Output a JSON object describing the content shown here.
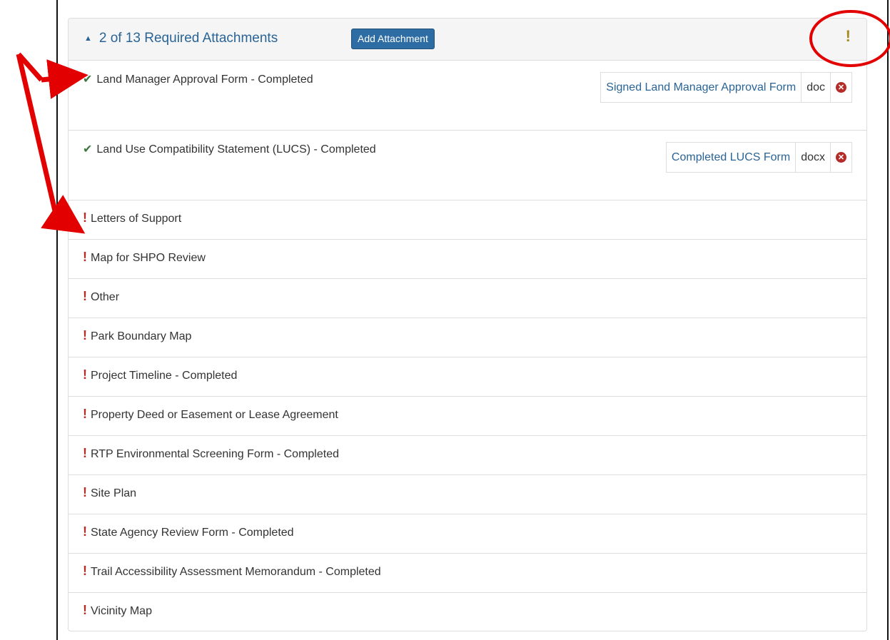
{
  "panel": {
    "heading": "2 of 13 Required Attachments",
    "add_button": "Add Attachment",
    "warning_icon": "!"
  },
  "icons": {
    "collapse": "caret-up-icon",
    "completed": "check-icon",
    "missing": "exclamation-icon",
    "delete": "remove-circle-icon"
  },
  "colors": {
    "link": "#2a6496",
    "button": "#2e6da4",
    "success": "#3c763d",
    "danger": "#b52b27",
    "warning": "#a68a24",
    "annotation": "#e30000"
  },
  "attachments": [
    {
      "label": "Land Manager Approval Form - Completed",
      "file_name": "Signed Land Manager Approval Form",
      "file_type": "doc"
    },
    {
      "label": "Land Use Compatibility Statement (LUCS) - Completed",
      "file_name": "Completed LUCS Form",
      "file_type": "docx"
    },
    {
      "label": "Letters of Support"
    },
    {
      "label": "Map for SHPO Review"
    },
    {
      "label": "Other"
    },
    {
      "label": "Park Boundary Map"
    },
    {
      "label": "Project Timeline - Completed"
    },
    {
      "label": "Property Deed or Easement or Lease Agreement"
    },
    {
      "label": "RTP Environmental Screening Form - Completed"
    },
    {
      "label": "Site Plan"
    },
    {
      "label": "State Agency Review Form - Completed"
    },
    {
      "label": "Trail Accessibility Assessment Memorandum - Completed"
    },
    {
      "label": "Vicinity Map"
    }
  ]
}
